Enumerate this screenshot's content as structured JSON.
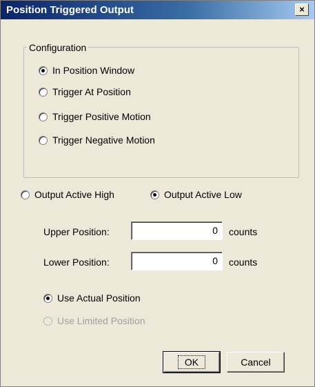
{
  "dialog": {
    "title": "Position Triggered Output",
    "close_glyph": "×"
  },
  "configuration": {
    "label": "Configuration",
    "options": [
      {
        "label": "In Position Window",
        "checked": true
      },
      {
        "label": "Trigger At Position",
        "checked": false
      },
      {
        "label": "Trigger Positive Motion",
        "checked": false
      },
      {
        "label": "Trigger Negative Motion",
        "checked": false
      }
    ]
  },
  "output": {
    "high_label": "Output Active High",
    "low_label": "Output Active Low",
    "selected": "low"
  },
  "positions": {
    "upper_label": "Upper Position:",
    "upper_value": "0",
    "lower_label": "Lower Position:",
    "lower_value": "0",
    "unit": "counts"
  },
  "source": {
    "actual_label": "Use Actual Position",
    "limited_label": "Use Limited Position",
    "selected": "actual"
  },
  "buttons": {
    "ok": "OK",
    "cancel": "Cancel"
  }
}
